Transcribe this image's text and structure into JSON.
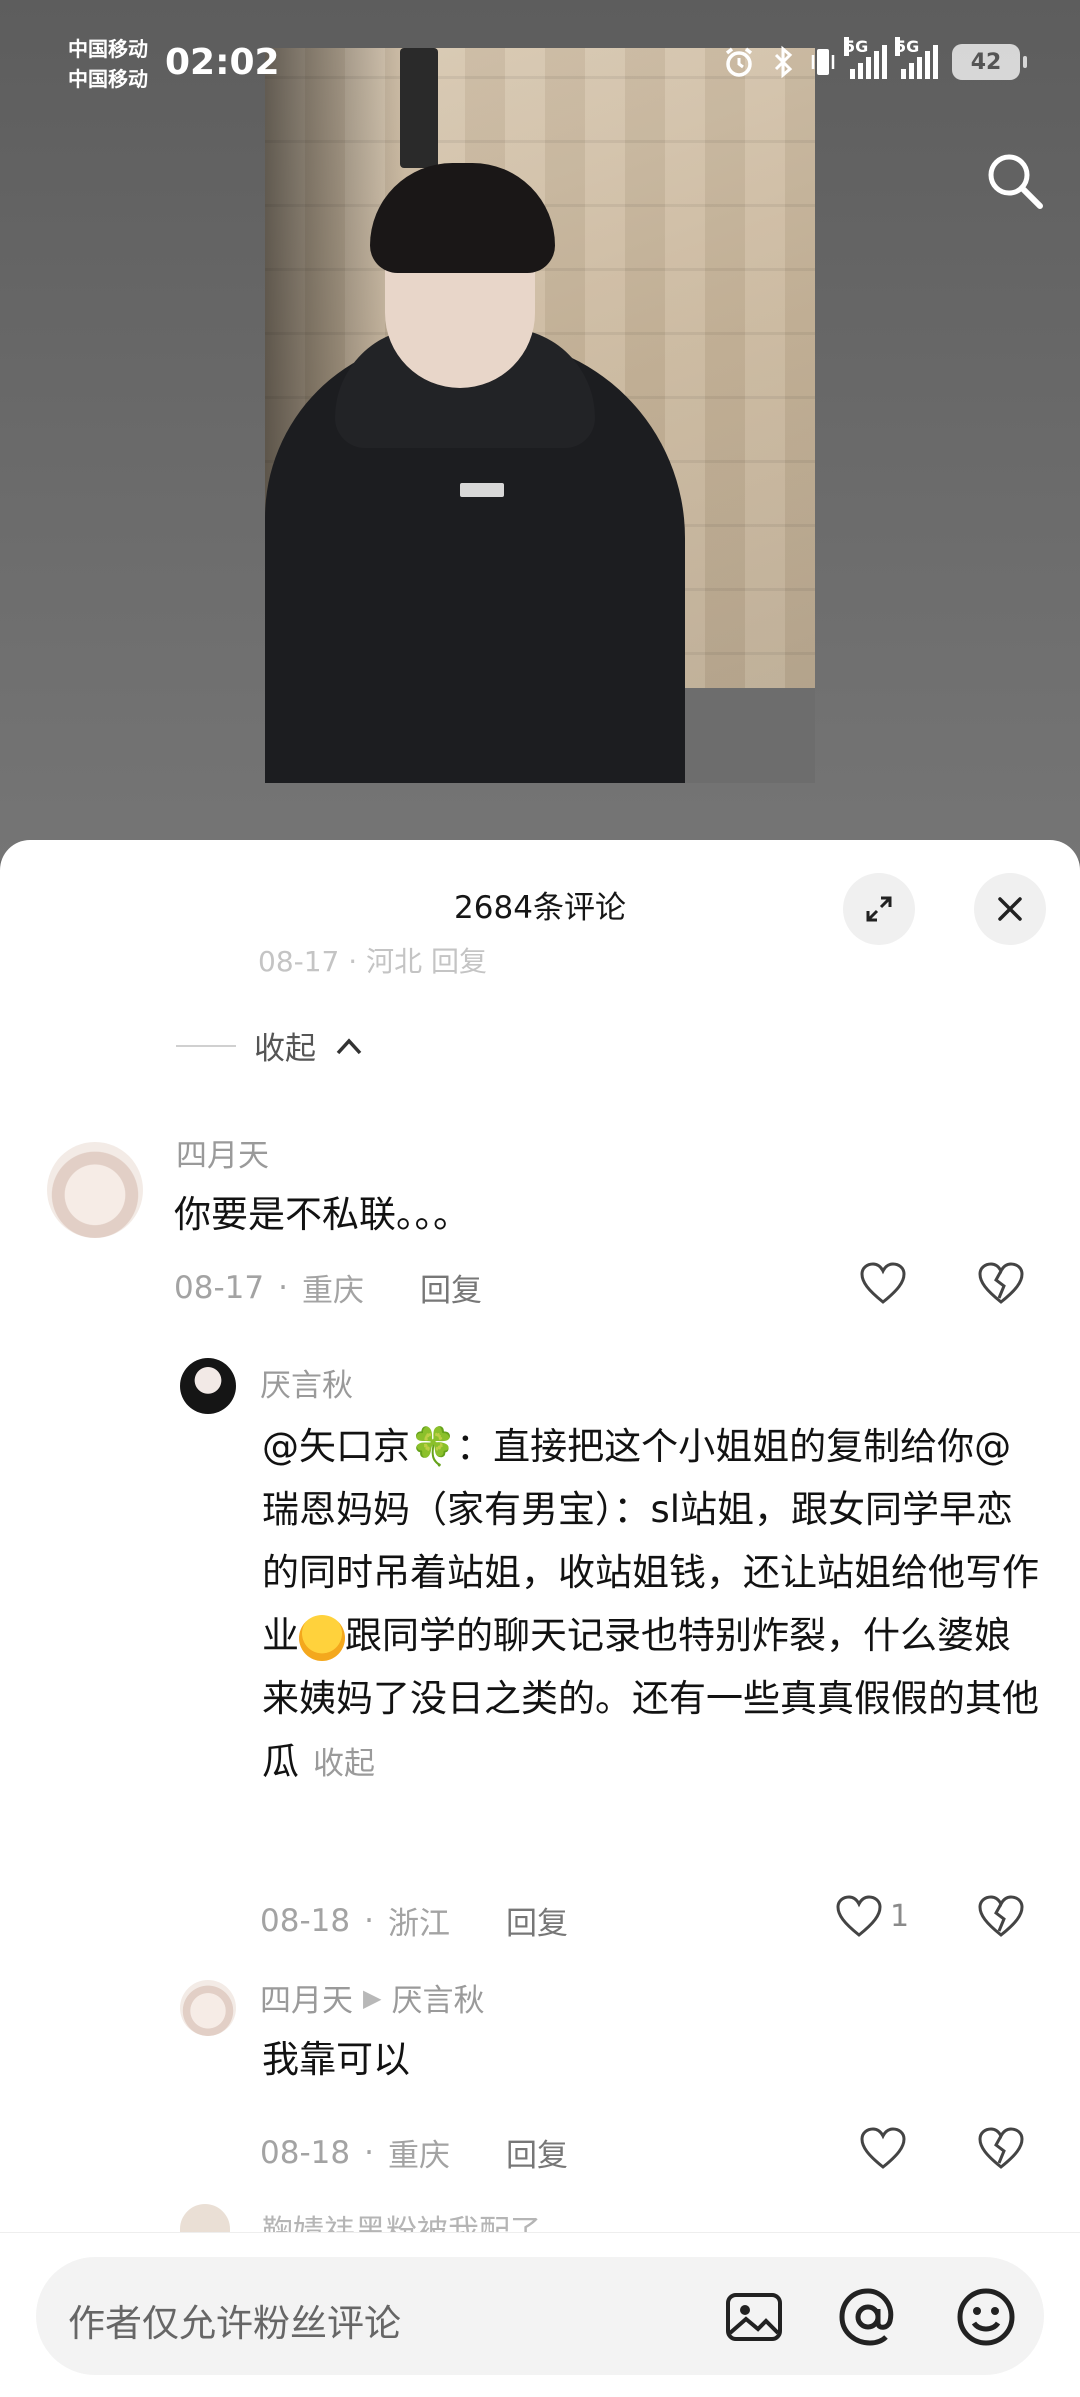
{
  "status_bar": {
    "carrier_1": "中国移动",
    "carrier_2": "中国移动",
    "time": "02:02",
    "net_1": "5G",
    "net_2": "5G",
    "battery": "42"
  },
  "sheet": {
    "title": "2684条评论",
    "cut_row_text": "08-17 · 河北  回复",
    "collapse_label": "收起"
  },
  "comments": [
    {
      "user": "四月天",
      "text": "你要是不私联。。。",
      "date": "08-17",
      "location": "重庆",
      "reply": "回复"
    },
    {
      "user": "厌言秋",
      "text_parts": {
        "mention": "@矢口京",
        "clover": "🍀",
        "line_a": "：直接把这个小姐姐的复制给你@瑞恩妈妈（家有男宝）：sl站姐，跟女同学早恋的同时吊着站姐，收站姐钱，还让站姐给他写作业",
        "line_b": "跟同学的聊天记录也特别炸裂，什么婆娘来姨妈了没日之类的。还有一些真真假假的其他瓜"
      },
      "fold": "收起",
      "date": "08-18",
      "location": "浙江",
      "reply": "回复",
      "likes": "1"
    },
    {
      "user": "四月天",
      "reply_to": "厌言秋",
      "text": "我靠可以",
      "date": "08-18",
      "location": "重庆",
      "reply": "回复"
    },
    {
      "user": "鞠婧祎黑粉被我配了"
    }
  ],
  "input": {
    "placeholder": "作者仅允许粉丝评论"
  }
}
